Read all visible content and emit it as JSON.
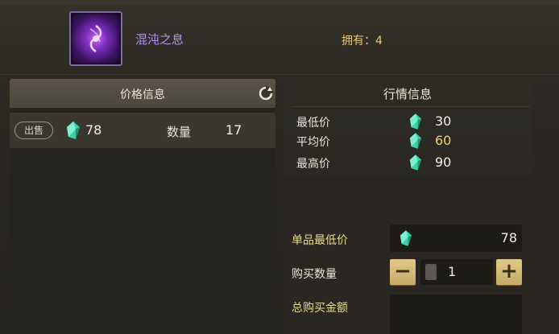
{
  "item": {
    "name": "混沌之息",
    "icon": "purple-swirl-icon",
    "owned_label": "拥有：4"
  },
  "price_panel": {
    "title": "价格信息",
    "refresh_icon": "refresh-icon",
    "row": {
      "sell_label": "出售",
      "currency_icon": "gem-icon",
      "price": "78",
      "qty_label": "数量",
      "qty": "17"
    }
  },
  "market": {
    "title": "行情信息",
    "rows": [
      {
        "label": "最低价",
        "value": "30"
      },
      {
        "label": "平均价",
        "value": "60"
      },
      {
        "label": "最高价",
        "value": "90"
      }
    ]
  },
  "purchase": {
    "unit_min_label": "单品最低价",
    "unit_min_value": "78",
    "qty_label": "购买数量",
    "qty_value": "1",
    "minus_label": "−",
    "plus_label": "+",
    "total_label": "总购买金额"
  },
  "colors": {
    "gold_text": "#f0d46a",
    "purple_name": "#b490f0",
    "button_gold": "#d4bc78"
  }
}
